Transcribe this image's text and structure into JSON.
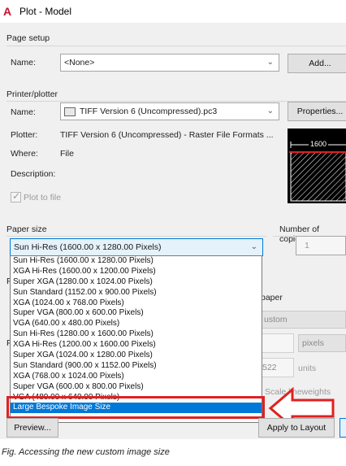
{
  "window": {
    "title": "Plot - Model",
    "app_icon": "autocad-logo-icon"
  },
  "page_setup": {
    "section_title": "Page setup",
    "name_label": "Name:",
    "name_value": "<None>",
    "add_button": "Add..."
  },
  "printer_plotter": {
    "section_title": "Printer/plotter",
    "name_label": "Name:",
    "name_value": "TIFF Version 6 (Uncompressed).pc3",
    "properties_button": "Properties...",
    "plotter_label": "Plotter:",
    "plotter_value": "TIFF Version 6 (Uncompressed) - Raster File Formats ...",
    "where_label": "Where:",
    "where_value": "File",
    "description_label": "Description:",
    "plot_to_file_label": "Plot to file",
    "plot_to_file_checked": true,
    "preview_dimension": "1600"
  },
  "paper_size": {
    "section_title": "Paper size",
    "selected": "Sun Hi-Res (1600.00 x 1280.00 Pixels)",
    "options": [
      "Sun Hi-Res (1600.00 x 1280.00 Pixels)",
      "XGA Hi-Res (1600.00 x 1200.00 Pixels)",
      "Super XGA (1280.00 x 1024.00 Pixels)",
      "Sun Standard (1152.00 x 900.00 Pixels)",
      "XGA (1024.00 x 768.00 Pixels)",
      "Super VGA (800.00 x 600.00 Pixels)",
      "VGA (640.00 x 480.00 Pixels)",
      "Sun Hi-Res (1280.00 x 1600.00 Pixels)",
      "XGA Hi-Res (1200.00 x 1600.00 Pixels)",
      "Super XGA (1024.00 x 1280.00 Pixels)",
      "Sun Standard (900.00 x 1152.00 Pixels)",
      "XGA (768.00 x 1024.00 Pixels)",
      "Super VGA (600.00 x 800.00 Pixels)",
      "VGA (480.00 x 640.00 Pixels)",
      "Large Bespoke Image Size"
    ],
    "highlighted_option": "Large Bespoke Image Size"
  },
  "number_of_copies": {
    "label": "Number of copies",
    "value": "1"
  },
  "plot_scale": {
    "fit_to_paper_label": "paper",
    "scale_value": "ustom",
    "units_select": "pixels",
    "units_value": "522",
    "units_label": "units",
    "scale_lineweights_label": "Scale lineweights"
  },
  "footer": {
    "preview_button": "Preview...",
    "apply_button": "Apply to Layout"
  },
  "annotation": {
    "arrow_color": "#e02020",
    "highlight_color": "#e02020"
  },
  "caption": "Fig. Accessing the new custom image size"
}
